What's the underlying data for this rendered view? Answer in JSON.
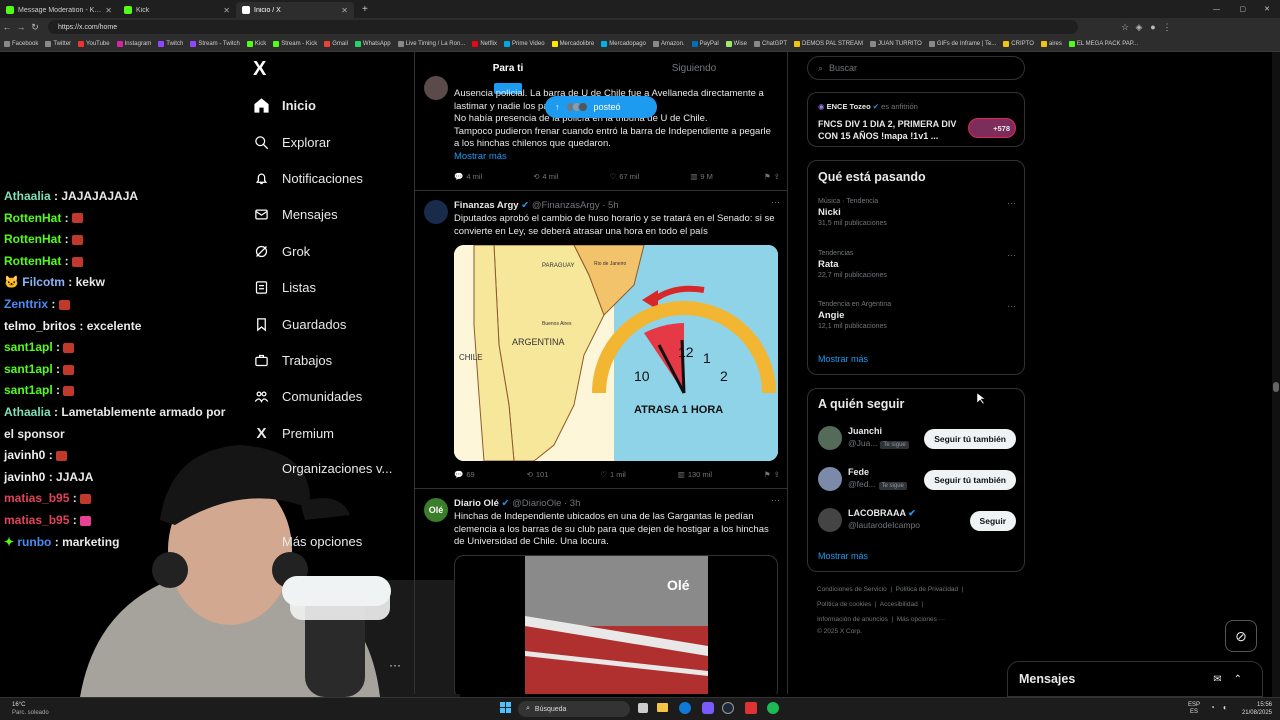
{
  "tabs": [
    {
      "label": "Message Moderation - Kick Dashb",
      "active": false
    },
    {
      "label": "Kick",
      "active": false
    },
    {
      "label": "Inicio / X",
      "active": true
    }
  ],
  "address": {
    "url": "https://x.com/home"
  },
  "bookmarks": [
    "Facebook",
    "Twitter",
    "YouTube",
    "Instagram",
    "Twitch",
    "Stream - Twitch",
    "Kick",
    "Stream - Kick",
    "Gmail",
    "WhatsApp",
    "Live Timing / La Ron...",
    "Netflix",
    "Prime Video",
    "Mercadolibre",
    "Mercadopago",
    "Amazon.",
    "PayPal",
    "Wise",
    "ChatGPT",
    "DEMOS PAL STREAM",
    "JUAN TURRITO",
    "GIFs de Inframe | Te...",
    "CRIPTO",
    "aires",
    "EL MEGA PACK PAP..."
  ],
  "chat": [
    {
      "user": "Athaalia",
      "color": "#7fe0b8",
      "text": "JAJAJAJAJA",
      "emote": false
    },
    {
      "user": "RottenHat",
      "color": "#53fc18",
      "text": "",
      "emote": true
    },
    {
      "user": "RottenHat",
      "color": "#53fc18",
      "text": "",
      "emote": true
    },
    {
      "user": "RottenHat",
      "color": "#53fc18",
      "text": "",
      "emote": true
    },
    {
      "user": "Filcotm",
      "color": "#8ab4f8",
      "text": "kekw",
      "emote": false
    },
    {
      "user": "Zenttrix",
      "color": "#4b8bf5",
      "text": "",
      "emote": true
    },
    {
      "user": "telmo_britos",
      "color": "#f0f0f0",
      "text": "excelente",
      "emote": false
    },
    {
      "user": "sant1apl",
      "color": "#53fc18",
      "text": "",
      "emote": true
    },
    {
      "user": "sant1apl",
      "color": "#53fc18",
      "text": "",
      "emote": true
    },
    {
      "user": "sant1apl",
      "color": "#53fc18",
      "text": "",
      "emote": true
    },
    {
      "user": "Athaalia",
      "color": "#7fe0b8",
      "text": "Lametablemente armado por",
      "emote": false
    },
    {
      "user": "",
      "color": "#ffffff",
      "text": "el sponsor",
      "emote": false
    },
    {
      "user": "javinh0",
      "color": "#f0f0f0",
      "text": "",
      "emote": true
    },
    {
      "user": "javinh0",
      "color": "#f0f0f0",
      "text": "JJAJA",
      "emote": false
    },
    {
      "user": "matias_b95",
      "color": "#e0445a",
      "text": "",
      "emote": true
    },
    {
      "user": "matias_b95",
      "color": "#e0445a",
      "text": "",
      "emote": true
    },
    {
      "user": "runbo",
      "color": "#4b8bf5",
      "text": "marketing",
      "emote": false
    }
  ],
  "nav": {
    "logo": "X",
    "items": [
      "Inicio",
      "Explorar",
      "Notificaciones",
      "Mensajes",
      "Grok",
      "Listas",
      "Guardados",
      "Trabajos",
      "Comunidades",
      "Premium",
      "Organizaciones v...",
      "Más opciones"
    ]
  },
  "feed": {
    "tabs": [
      "Para ti",
      "Siguiendo"
    ],
    "posted_pill": "posteó",
    "tweet1": {
      "lines": [
        "Ausencia policial. La barra de U de Chile fue a Avellaneda directamente a",
        "lastimar y nadie los paró.",
        "No había presencia de la policía en la tribuna de U de Chile.",
        "Tampoco pudieron frenar cuando entró la barra de Independiente a pegarle",
        "a los hinchas chilenos que quedaron."
      ],
      "more": "Mostrar más",
      "stats": [
        "4 mil",
        "4 mil",
        "67 mil",
        "9 M"
      ]
    },
    "tweet2": {
      "name": "Finanzas Argy",
      "handle": "@FinanzasArgy · 5h",
      "text": "Diputados aprobó el cambio de huso horario y se tratará en el Senado: si se convierte en Ley, se deberá atrasar una hora en todo el país",
      "image_caption": "ATRASA 1 HORA",
      "map_labels": [
        "ARGENTINA",
        "CHILE",
        "PARAGUAY",
        "Buenos Aires",
        "Rio de Janeiro"
      ],
      "clock_numbers": [
        "10",
        "12",
        "1",
        "2"
      ],
      "stats": [
        "69",
        "101",
        "1 mil",
        "130 mil"
      ]
    },
    "tweet3": {
      "name": "Diario Olé",
      "handle": "@DiarioOle · 3h",
      "text": "Hinchas de Independiente ubicados en una de las Gargantas le pedían clemencia a los barras de su club para que dejen de hostigar a los hinchas de Universidad de Chile. Una locura.",
      "video_logo": "Olé"
    }
  },
  "search": {
    "placeholder": "Buscar"
  },
  "space": {
    "host": "ENCE Tozeo",
    "host_suffix": "es anfitrión",
    "title": "FNCS DIV 1 DIA 2, PRIMERA DIV CON 15 AÑOS !mapa !1v1 ...",
    "count": "+578"
  },
  "trending": {
    "title": "Qué está pasando",
    "items": [
      {
        "context": "Música · Tendencia",
        "name": "Nicki",
        "posts": "31,5 mil publicaciones"
      },
      {
        "context": "Tendencias",
        "name": "Rata",
        "posts": "22,7 mil publicaciones"
      },
      {
        "context": "Tendencia en Argentina",
        "name": "Angie",
        "posts": "12,1 mil publicaciones"
      }
    ],
    "more": "Mostrar más"
  },
  "who_to_follow": {
    "title": "A quién seguir",
    "items": [
      {
        "name": "Juanchi",
        "handle": "@Jua...",
        "badge": "Te sigue",
        "button": "Seguir tú también"
      },
      {
        "name": "Fede",
        "handle": "@fed...",
        "badge": "Te sigue",
        "button": "Seguir tú también"
      },
      {
        "name": "LACOBRAAA",
        "handle": "@lautarodeIcampo",
        "badge": "",
        "button": "Seguir"
      }
    ],
    "more": "Mostrar más"
  },
  "footer": {
    "line1": [
      "Condiciones de Servicio",
      "Política de Privacidad"
    ],
    "line2": [
      "Política de cookies",
      "Accesibilidad"
    ],
    "line3": [
      "Información de anuncios",
      "Más opciones ···"
    ],
    "copyright": "© 2025 X Corp."
  },
  "messages_dock": {
    "title": "Mensajes"
  },
  "taskbar": {
    "weather_temp": "16°C",
    "weather_desc": "Parc. soleado",
    "search": "Búsqueda",
    "lang": "ESP",
    "lang2": "ES",
    "time": "15:56",
    "date": "21/08/2025"
  }
}
